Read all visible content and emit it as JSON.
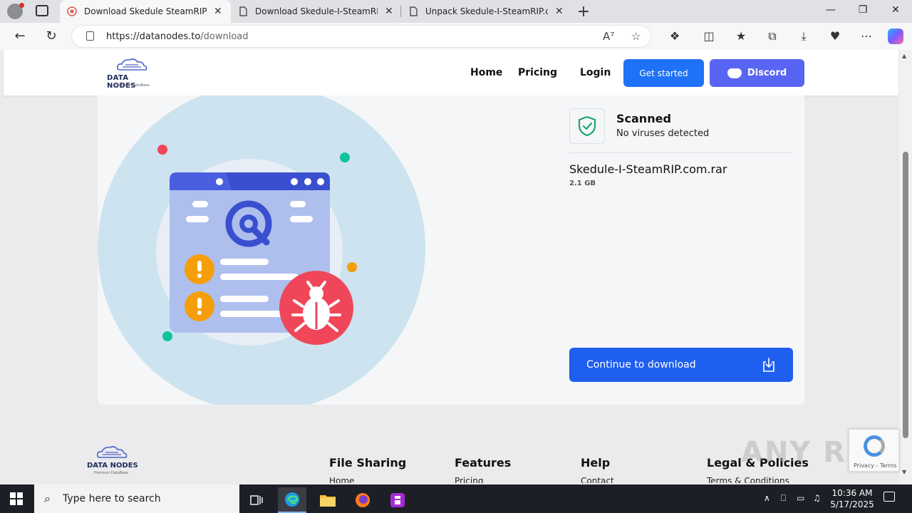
{
  "browser": {
    "tabs": [
      {
        "title": "Download Skedule SteamRIP.com",
        "active": true
      },
      {
        "title": "Download Skedule-I-SteamRIP.com",
        "active": false
      },
      {
        "title": "Unpack Skedule-I-SteamRIP.com",
        "active": false
      }
    ],
    "url_host": "https://datanodes.to",
    "url_path": "/download",
    "close_glyph": "✕",
    "new_tab_glyph": "+"
  },
  "site": {
    "logo_brand": "DATA NODES",
    "logo_tagline": "Premium DataBase",
    "nav": {
      "home": "Home",
      "pricing": "Pricing",
      "login": "Login",
      "get_started": "Get started",
      "discord": "Discord"
    },
    "scan": {
      "title": "Scanned",
      "subtitle": "No viruses detected"
    },
    "file": {
      "name": "Skedule-I-SteamRIP.com.rar",
      "size": "2.1 GB"
    },
    "download_button": "Continue to download",
    "footer": {
      "columns": [
        {
          "title": "File Sharing",
          "first_link": "Home"
        },
        {
          "title": "Features",
          "first_link": "Pricing"
        },
        {
          "title": "Help",
          "first_link": "Contact"
        },
        {
          "title": "Legal & Policies",
          "first_link": "Terms & Conditions"
        }
      ]
    },
    "recaptcha_text": "Privacy - Terms",
    "watermark": "ANY RUN"
  },
  "taskbar": {
    "search_placeholder": "Type here to search",
    "time": "10:36 AM",
    "date": "5/17/2025"
  },
  "colors": {
    "primary_blue": "#1f72f5",
    "discord": "#5865f2",
    "bug_red": "#f0465a",
    "warning_orange": "#f59e0b",
    "shield_green": "#1aa56b"
  }
}
